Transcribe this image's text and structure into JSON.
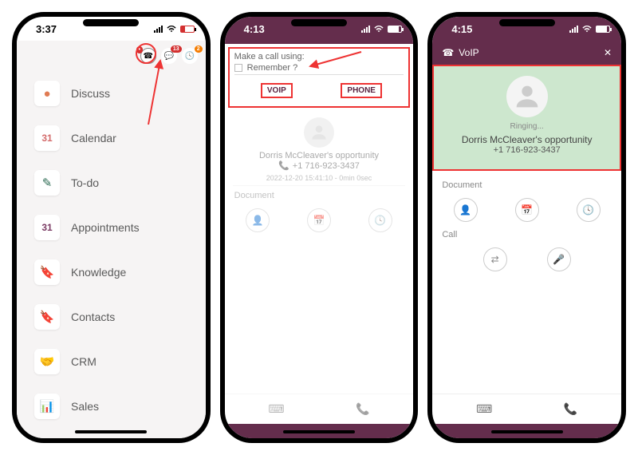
{
  "phone1": {
    "time": "3:37",
    "notif1": "13",
    "notif2": "2",
    "menu": [
      {
        "icon": "💬",
        "label": "Discuss",
        "color": "#e07b53"
      },
      {
        "icon": "31",
        "label": "Calendar",
        "color": "#d36b6b"
      },
      {
        "icon": "✎",
        "label": "To-do",
        "color": "#2b6a52"
      },
      {
        "icon": "31",
        "label": "Appointments",
        "color": "#7a3a63"
      },
      {
        "icon": "📕",
        "label": "Knowledge",
        "color": "#3a7a6a"
      },
      {
        "icon": "📘",
        "label": "Contacts",
        "color": "#5aa8b5"
      },
      {
        "icon": "❤",
        "label": "CRM",
        "color": "#3fb6a8"
      },
      {
        "icon": "📊",
        "label": "Sales",
        "color": "#d6a04a"
      }
    ]
  },
  "phone2": {
    "time": "4:13",
    "dialog_title": "Make a call using:",
    "remember": "Remember ?",
    "btn_voip": "VOIP",
    "btn_phone": "PHONE",
    "opportunity": "Dorris McCleaver's opportunity",
    "number": "+1 716-923-3437",
    "timestamp": "2022-12-20 15:41:10 - 0min 0sec",
    "section1": "Document"
  },
  "phone3": {
    "time": "4:15",
    "header": "VoIP",
    "ringing": "Ringing...",
    "opportunity": "Dorris McCleaver's opportunity",
    "number": "+1 716-923-3437",
    "section1": "Document",
    "section2": "Call"
  }
}
